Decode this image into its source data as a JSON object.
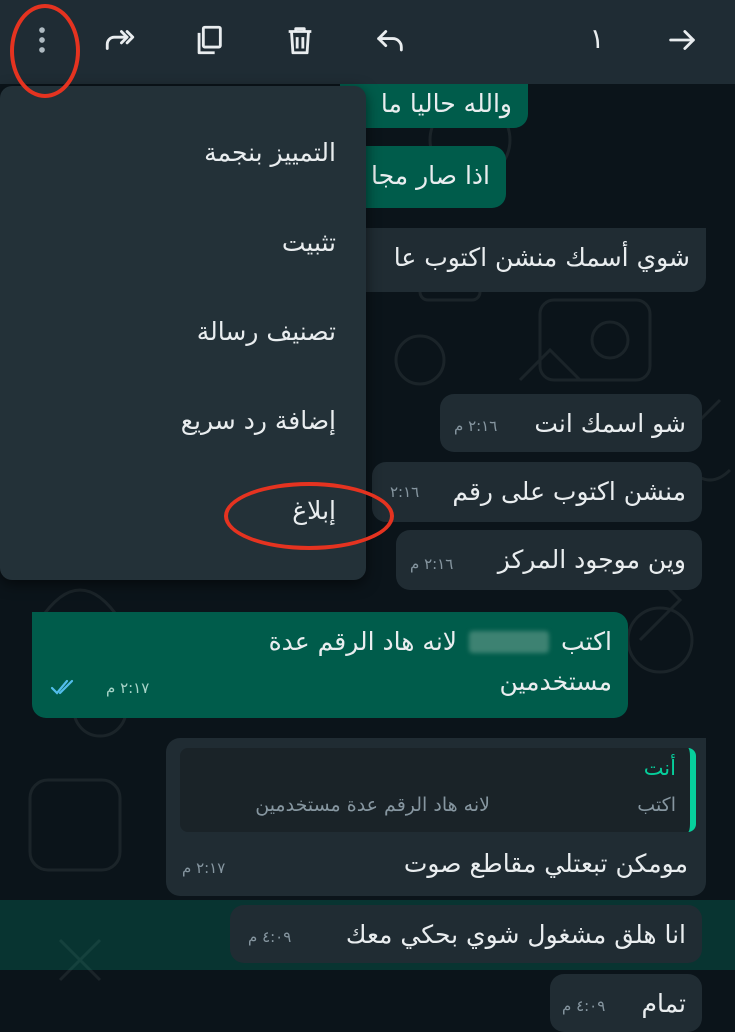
{
  "top_bar": {
    "selected_count": "١",
    "icons": [
      "more-vert-icon",
      "forward-all-icon",
      "copy-icon",
      "delete-icon",
      "reply-icon",
      "arrow-right-icon"
    ]
  },
  "menu": {
    "items": [
      {
        "label": "التمييز بنجمة"
      },
      {
        "label": "تثبيت"
      },
      {
        "label": "تصنيف رسالة"
      },
      {
        "label": "إضافة رد سريع"
      },
      {
        "label": "إبلاغ"
      }
    ]
  },
  "messages": [
    {
      "dir": "out",
      "text": "والله حاليا ما"
    },
    {
      "dir": "out",
      "text": "اذا صار مجا"
    },
    {
      "dir": "in",
      "text": "شوي  أسمك  منشن اكتوب عا"
    },
    {
      "dir": "in",
      "text": "شو اسمك انت",
      "time": "٢:١٦ م"
    },
    {
      "dir": "in",
      "text": "منشن اكتوب على رقم",
      "time": "٢:١٦"
    },
    {
      "dir": "in",
      "text": "وين موجود المركز",
      "time": "٢:١٦ م"
    },
    {
      "dir": "out",
      "text_line1": "اكتب",
      "text_line1b": "لانه هاد الرقم عدة",
      "text_line2": "مستخدمين",
      "time": "٢:١٧ م"
    },
    {
      "dir": "in",
      "quote_author": "أنت",
      "quote_text_start": "اكتب",
      "quote_text": "لانه هاد الرقم عدة مستخدمين",
      "text": "مومكن تبعتلي مقاطع صوت",
      "time": "٢:١٧ م"
    },
    {
      "dir": "in",
      "text": "انا هلق  مشغول شوي بحكي معك",
      "time": "٤:٠٩ م"
    },
    {
      "dir": "in",
      "text": "تمام",
      "time": "٤:٠٩ م"
    }
  ],
  "colors": {
    "background": "#0b141a",
    "top_bar": "#1f2c34",
    "incoming_bubble": "#202c33",
    "outgoing_bubble": "#005c4b",
    "menu": "#233138",
    "annotation_ring": "#e53320",
    "read_ticks": "#53bdeb",
    "quote_author": "#06cf9c"
  }
}
